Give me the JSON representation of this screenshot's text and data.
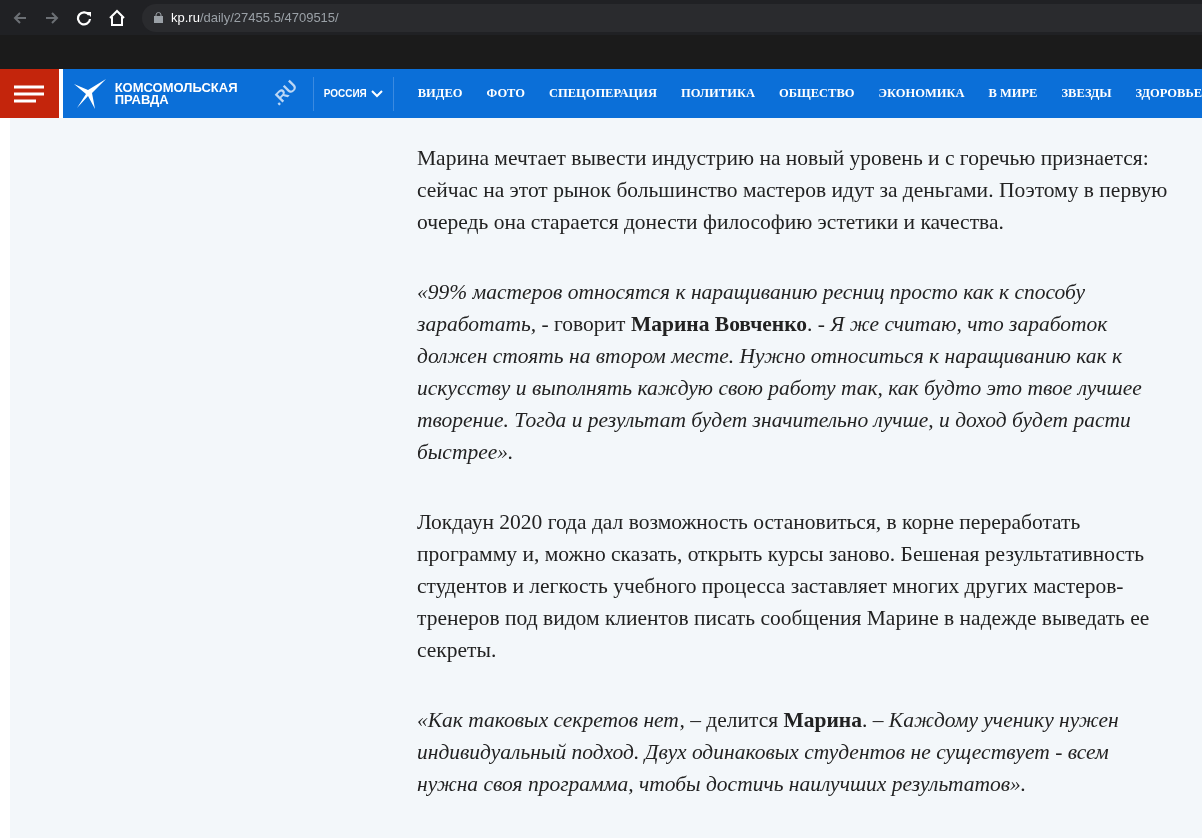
{
  "browser": {
    "url_host": "kp.ru",
    "url_path": "/daily/27455.5/4709515/"
  },
  "site_header": {
    "logo_line_1": "КОМСОМОЛЬСКАЯ",
    "logo_line_2": "ПРАВДА",
    "logo_domain": ".RU",
    "region": "РОССИЯ",
    "nav": [
      "ВИДЕО",
      "ФОТО",
      "СПЕЦОПЕРАЦИЯ",
      "ПОЛИТИКА",
      "ОБЩЕСТВО",
      "ЭКОНОМИКА",
      "В МИРЕ",
      "ЗВЕЗДЫ",
      "ЗДОРОВЬЕ"
    ]
  },
  "article": {
    "paragraphs": [
      {
        "text": "Марина мечтает вывести индустрию на новый уровень и с горечью признается: сейчас на этот рынок большинство мастеров идут за деньгами. Поэтому в первую очередь она старается донести философию эстетики и качества."
      },
      {
        "text": "*«99% мастеров относятся к наращиванию ресниц просто как к способу заработать,* - говорит **Марина Вовченко**. *- Я же считаю, что заработок должен стоять на втором месте. Нужно относиться к наращиванию как к искусству и выполнять каждую свою работу так, как будто это твое лучшее творение. Тогда и результат будет значительно лучше, и доход будет расти быстрее».*"
      },
      {
        "text": "Локдаун 2020 года дал возможность остановиться, в корне переработать программу и, можно сказать, открыть курсы заново. Бешеная результативность студентов и легкость учебного процесса заставляет многих других мастеров-тренеров под видом клиентов писать сообщения Марине в надежде выведать ее секреты."
      },
      {
        "text": "*«Как таковых секретов нет, –* делится **Марина**. *– Каждому ученику нужен индивидуальный подход. Двух одинаковых студентов не существует - всем нужна своя программа, чтобы достичь наилучших результатов».*"
      }
    ]
  }
}
